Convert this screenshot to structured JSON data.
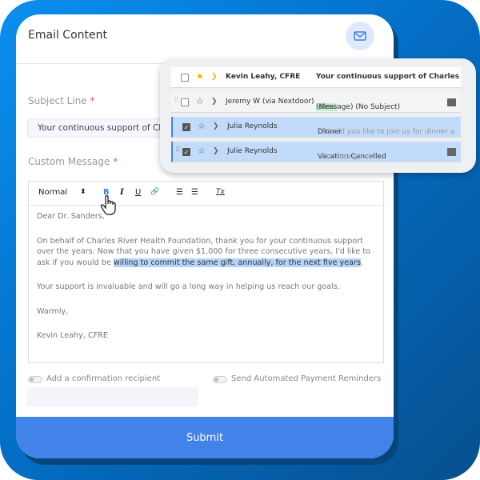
{
  "card": {
    "title": "Email Content",
    "subject_label": "Subject Line",
    "required_mark": "*",
    "subject_value": "Your continuous support of Charles River Health Foundation",
    "message_label": "Custom Message"
  },
  "toolbar": {
    "format": "Normal",
    "format_arrow": "⬍",
    "bold": "B",
    "italic": "I",
    "underline": "U",
    "link": "🔗",
    "ordered": "☰",
    "bullets": "☰",
    "clear": "Tx"
  },
  "message": {
    "greeting": "Dear Dr. Sanders,",
    "para1_start": "On behalf of Charles River Health Foundation, thank you for your continuous support over the years. Now that you have given $1,000 for three consecutive years, I'd like to ask if you would be ",
    "para1_highlight": "willing to commit the same gift, annually, for the next five years",
    "para1_end": ".",
    "para2": "Your support is invaluable and will go a long way in helping us reach our goals.",
    "closing": "Warmly,",
    "signature": "Kevin Leahy, CFRE"
  },
  "options": {
    "confirmation": "Add a confirmation recipient",
    "reminders": "Send Automated Payment Reminders"
  },
  "submit": "Submit",
  "inbox": [
    {
      "sender": "Kevin Leahy, CFRE",
      "subject": "Your continuous support of Charles River Health Foundation",
      "snippet": "",
      "badge": "",
      "checked": false,
      "starred": true
    },
    {
      "sender": "Jeremy W (via Nextdoor)",
      "subject": "(Message) (No Subject)",
      "snippet": " - N",
      "badge": "Social",
      "checked": false,
      "starred": false
    },
    {
      "sender": "Julia Reynolds",
      "subject": "Dinner",
      "snippet": " - Would you like to join us for dinner a",
      "badge": "",
      "checked": true,
      "starred": false
    },
    {
      "sender": "Julie Reynolds",
      "subject": "Vacation Cancelled",
      "snippet": " - I'm sure you c",
      "badge": "",
      "checked": true,
      "starred": false
    }
  ],
  "colors": {
    "accent": "#4183e8",
    "selected_row": "#c2dbfb",
    "star": "#f4b400"
  }
}
